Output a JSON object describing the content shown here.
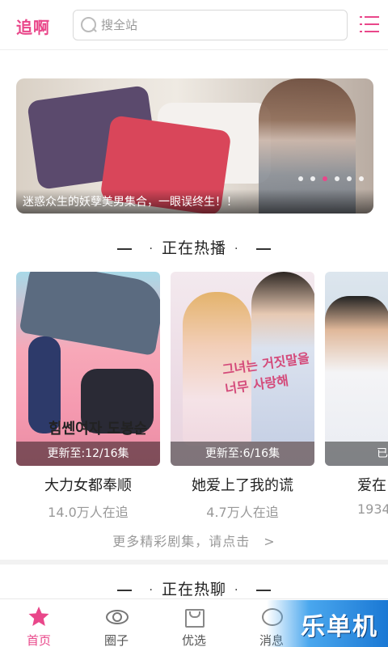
{
  "header": {
    "logo": "追啊",
    "search_placeholder": "搜全站"
  },
  "banner": {
    "caption": "迷惑众生的妖孽美男集合，一眼误终生！！",
    "dot_count": 6,
    "active_dot": 2
  },
  "hot_playing": {
    "title": "正在热播",
    "cards": [
      {
        "title": "大力女都奉顺",
        "update": "更新至:12/16集",
        "watchers": "14.0万人在追",
        "poster_text": "힘쎈여자 도봉순"
      },
      {
        "title": "她爱上了我的谎",
        "update": "更新至:6/16集",
        "watchers": "4.7万人在追",
        "poster_text": "그녀는 거짓말을 너무 사랑해"
      },
      {
        "title": "爱在",
        "update": "已",
        "watchers": "1934",
        "poster_text": ""
      }
    ],
    "more": "更多精彩剧集，请点击　>"
  },
  "hot_talking": {
    "title": "正在热聊"
  },
  "bottom_nav": [
    {
      "label": "首页",
      "icon": "star-icon",
      "active": true
    },
    {
      "label": "圈子",
      "icon": "eye-icon",
      "active": false
    },
    {
      "label": "优选",
      "icon": "shopping-bag-icon",
      "active": false
    },
    {
      "label": "消息",
      "icon": "message-icon",
      "active": false
    }
  ],
  "watermark": "乐单机",
  "colors": {
    "accent": "#e9478a",
    "muted_text": "#999999"
  }
}
